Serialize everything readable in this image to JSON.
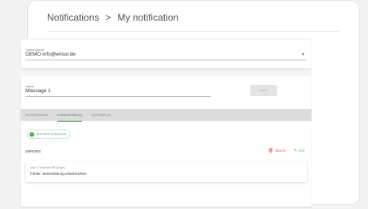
{
  "breadcrumb": {
    "root": "Notifications",
    "separator": ">",
    "current": "My notification"
  },
  "device": {
    "label": "Select device",
    "value": "DEMO info@ensol.de"
  },
  "notification": {
    "name_label": "Name",
    "name_value": "Massage 1",
    "save_label": "SAVE"
  },
  "tabs": [
    {
      "label": "NOTIFICATION"
    },
    {
      "label": "CONDITIONS (1)"
    },
    {
      "label": "ACTIONS (0)"
    }
  ],
  "add_condition_label": "ADD NEW CONDITION",
  "errors": {
    "title": "ERRORS",
    "delete_label": "DELETE",
    "edit_label": "EDIT",
    "item_sub": "Mux 1: Detected ER (Kugel)",
    "item_message": "Fehler: Sensorleitung unterbrochen"
  }
}
